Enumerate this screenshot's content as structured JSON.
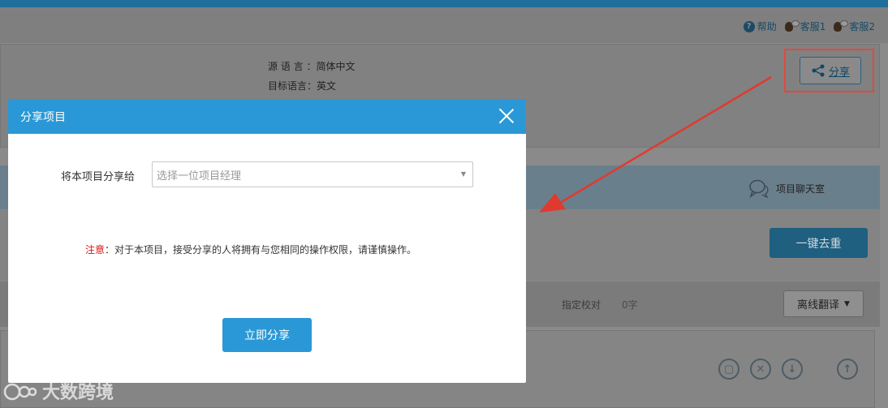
{
  "header": {
    "help_label": "帮助",
    "service1_label": "客服1",
    "service2_label": "客服2"
  },
  "project_info": {
    "source_language": "源 语 言 ：简体中文",
    "target_language": "目标语言：英文",
    "share_button_label": "分享"
  },
  "tabs": {
    "chat_room_label": "项目聊天室"
  },
  "actions": {
    "dedup_button_label": "一键去重",
    "assign_review_label": "指定校对",
    "word_count": "0字",
    "offline_translate_label": "离线翻译"
  },
  "watermark_text": "大数跨境",
  "modal": {
    "title": "分享项目",
    "share_to_label": "将本项目分享给",
    "select_placeholder": "选择一位项目经理",
    "notice_prefix": "注意",
    "notice_text": "：对于本项目，接受分享的人将拥有与您相同的操作权限，请谨慎操作。",
    "submit_label": "立即分享"
  },
  "colors": {
    "accent": "#2a98d6",
    "highlight_border": "#e04a3f",
    "warning_text": "#dd1111"
  }
}
